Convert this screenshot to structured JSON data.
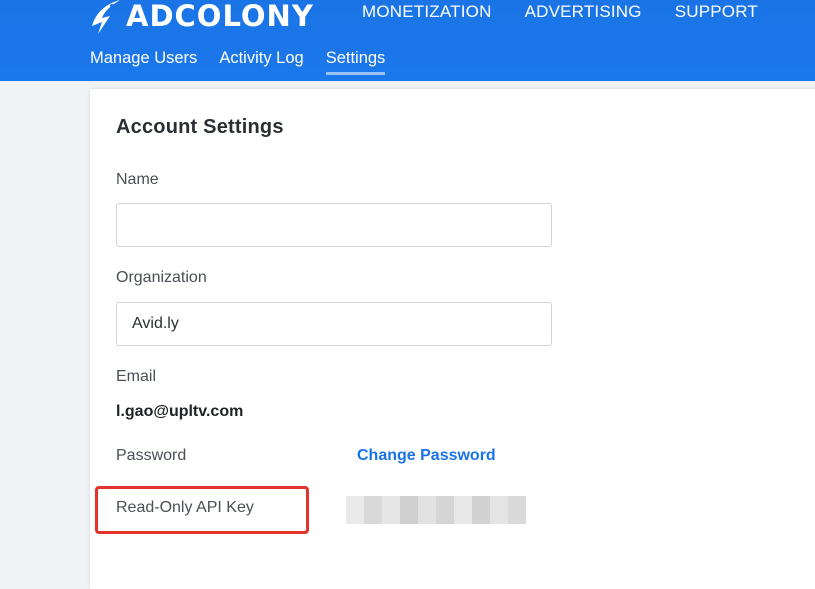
{
  "brand": {
    "name": "ADCOLONY",
    "color": "#1a73e8"
  },
  "topnav": {
    "items": [
      {
        "label": "MONETIZATION"
      },
      {
        "label": "ADVERTISING"
      },
      {
        "label": "SUPPORT"
      }
    ]
  },
  "subnav": {
    "items": [
      {
        "label": "Manage Users",
        "active": false
      },
      {
        "label": "Activity Log",
        "active": false
      },
      {
        "label": "Settings",
        "active": true
      }
    ]
  },
  "account": {
    "title": "Account Settings",
    "name_label": "Name",
    "name_value": "",
    "organization_label": "Organization",
    "organization_value": "Avid.ly",
    "email_label": "Email",
    "email_value": "l.gao@upltv.com",
    "password_label": "Password",
    "change_password_label": "Change Password",
    "api_key_label": "Read-Only API Key"
  },
  "colors": {
    "header": "#1a73e8",
    "link": "#1a73e8",
    "highlight": "#e3332c"
  },
  "icons": {
    "logo": "adcolony-lightning-logo-icon"
  }
}
